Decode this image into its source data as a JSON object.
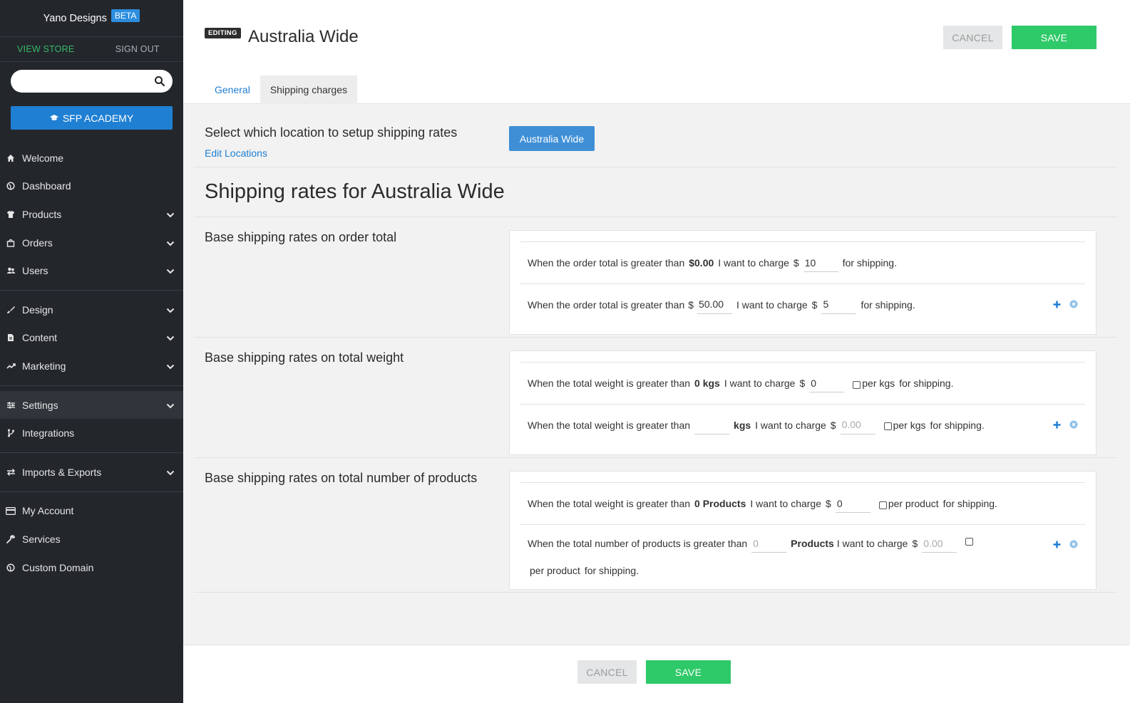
{
  "sidebar": {
    "brand": "Yano Designs",
    "beta": "BETA",
    "view_store": "VIEW STORE",
    "sign_out": "SIGN OUT",
    "search_placeholder": "",
    "academy": "SFP ACADEMY",
    "items": [
      {
        "label": "Welcome",
        "icon": "home-icon"
      },
      {
        "label": "Dashboard",
        "icon": "globe-icon"
      },
      {
        "label": "Products",
        "icon": "shirt-icon"
      },
      {
        "label": "Orders",
        "icon": "bag-icon"
      },
      {
        "label": "Users",
        "icon": "users-icon"
      },
      {
        "label": "Design",
        "icon": "brush-icon"
      },
      {
        "label": "Content",
        "icon": "file-icon"
      },
      {
        "label": "Marketing",
        "icon": "trend-icon"
      },
      {
        "label": "Settings",
        "icon": "sliders-icon"
      },
      {
        "label": "Integrations",
        "icon": "fork-icon"
      },
      {
        "label": "Imports & Exports",
        "icon": "transfer-icon"
      },
      {
        "label": "My Account",
        "icon": "card-icon"
      },
      {
        "label": "Services",
        "icon": "wrench-icon"
      },
      {
        "label": "Custom Domain",
        "icon": "globe-icon"
      }
    ]
  },
  "header": {
    "badge": "EDITING",
    "title": "Australia Wide",
    "cancel": "CANCEL",
    "save": "SAVE",
    "tabs": [
      "General",
      "Shipping charges"
    ]
  },
  "location": {
    "title": "Select which location to setup shipping rates",
    "edit_link": "Edit Locations",
    "selected": "Australia Wide"
  },
  "rates_title": "Shipping rates for Australia Wide",
  "order_total": {
    "title": "Base shipping rates on order total",
    "rule1": {
      "prefix": "When the order total is greater than",
      "threshold": "$0.00",
      "mid": "I want to charge",
      "currency": "$",
      "charge": "10",
      "suffix": "for shipping."
    },
    "rule2": {
      "prefix": "When the order total is greater than",
      "currency_a": "$",
      "threshold": "50.00",
      "mid": "I want to charge",
      "currency": "$",
      "charge": "5",
      "suffix": "for shipping."
    }
  },
  "total_weight": {
    "title": "Base shipping rates on total weight",
    "rule1": {
      "prefix": "When the total weight is greater than",
      "threshold": "0 kgs",
      "mid": "I want to charge",
      "currency": "$",
      "charge": "0",
      "per": "per kgs",
      "suffix": "for shipping."
    },
    "rule2": {
      "prefix": "When the total weight is greater than",
      "threshold": "",
      "unit": "kgs",
      "mid": "I want to charge",
      "currency": "$",
      "charge_placeholder": "0.00",
      "per": "per kgs",
      "suffix": "for shipping."
    }
  },
  "total_products": {
    "title": "Base shipping rates on total number of products",
    "rule1": {
      "prefix": "When the total weight is greater than",
      "threshold": "0 Products",
      "mid": "I want to charge",
      "currency": "$",
      "charge": "0",
      "per": "per product",
      "suffix": "for shipping."
    },
    "rule2": {
      "prefix": "When the total number of products is greater than",
      "threshold_placeholder": "0",
      "unit": "Products",
      "mid": "I want to charge",
      "currency": "$",
      "charge_placeholder": "0.00",
      "per": "per product",
      "suffix": "for shipping."
    }
  },
  "footer": {
    "cancel": "CANCEL",
    "save": "SAVE"
  },
  "colors": {
    "sidebar_bg": "#23272c",
    "accent_blue": "#1f7fd3",
    "save_green": "#2ec968",
    "view_store_green": "#36b868"
  }
}
